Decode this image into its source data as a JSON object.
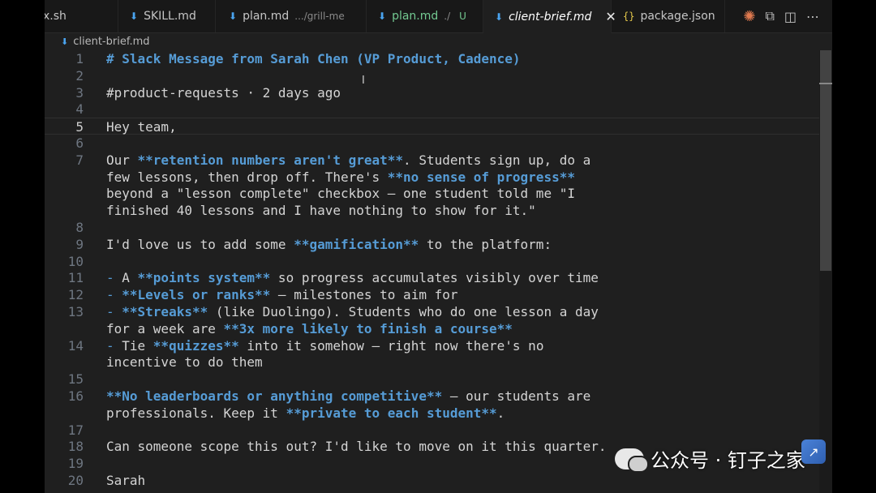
{
  "tabs": [
    {
      "label": "x.sh",
      "active": false
    },
    {
      "label": "SKILL.md",
      "active": false
    },
    {
      "label": "plan.md",
      "path": ".../grill-me",
      "active": false
    },
    {
      "label": "plan.md",
      "path": "./",
      "status": "U",
      "active": false
    },
    {
      "label": "client-brief.md",
      "active": true
    },
    {
      "label": "package.json",
      "active": false
    }
  ],
  "breadcrumb": "client-brief.md",
  "lines": [
    {
      "n": "1",
      "segs": [
        {
          "t": "# Slack Message from Sarah Chen (VP Product, Cadence)",
          "s": "h"
        }
      ]
    },
    {
      "n": "2",
      "segs": []
    },
    {
      "n": "3",
      "segs": [
        {
          "t": "#product-requests · 2 days ago",
          "s": ""
        }
      ]
    },
    {
      "n": "4",
      "segs": []
    },
    {
      "n": "5",
      "segs": [
        {
          "t": "Hey team,",
          "s": ""
        }
      ],
      "current": true
    },
    {
      "n": "6",
      "segs": []
    },
    {
      "n": "7",
      "segs": [
        {
          "t": "Our ",
          "s": ""
        },
        {
          "t": "**retention numbers aren't great**",
          "s": "b"
        },
        {
          "t": ". Students sign up, do a",
          "s": ""
        }
      ]
    },
    {
      "n": "",
      "segs": [
        {
          "t": "few lessons, then drop off. There's ",
          "s": ""
        },
        {
          "t": "**no sense of progress**",
          "s": "b"
        }
      ]
    },
    {
      "n": "",
      "segs": [
        {
          "t": "beyond a \"lesson complete\" checkbox — one student told me \"I",
          "s": ""
        }
      ]
    },
    {
      "n": "",
      "segs": [
        {
          "t": "finished 40 lessons and I have nothing to show for it.\"",
          "s": ""
        }
      ]
    },
    {
      "n": "8",
      "segs": []
    },
    {
      "n": "9",
      "segs": [
        {
          "t": "I'd love us to add some ",
          "s": ""
        },
        {
          "t": "**gamification**",
          "s": "b"
        },
        {
          "t": " to the platform:",
          "s": ""
        }
      ]
    },
    {
      "n": "10",
      "segs": []
    },
    {
      "n": "11",
      "segs": [
        {
          "t": "- ",
          "s": "dash"
        },
        {
          "t": "A ",
          "s": ""
        },
        {
          "t": "**points system**",
          "s": "b"
        },
        {
          "t": " so progress accumulates visibly over time",
          "s": ""
        }
      ]
    },
    {
      "n": "12",
      "segs": [
        {
          "t": "- ",
          "s": "dash"
        },
        {
          "t": "**Levels or ranks**",
          "s": "b"
        },
        {
          "t": " — milestones to aim for",
          "s": ""
        }
      ]
    },
    {
      "n": "13",
      "segs": [
        {
          "t": "- ",
          "s": "dash"
        },
        {
          "t": "**Streaks**",
          "s": "b"
        },
        {
          "t": " (like Duolingo). Students who do one lesson a day",
          "s": ""
        }
      ]
    },
    {
      "n": "",
      "segs": [
        {
          "t": "for a week are ",
          "s": ""
        },
        {
          "t": "**3x more likely to finish a course**",
          "s": "b"
        }
      ]
    },
    {
      "n": "14",
      "segs": [
        {
          "t": "- ",
          "s": "dash"
        },
        {
          "t": "Tie ",
          "s": ""
        },
        {
          "t": "**quizzes**",
          "s": "b"
        },
        {
          "t": " into it somehow — right now there's no",
          "s": ""
        }
      ]
    },
    {
      "n": "",
      "segs": [
        {
          "t": "incentive to do them",
          "s": ""
        }
      ]
    },
    {
      "n": "15",
      "segs": []
    },
    {
      "n": "16",
      "segs": [
        {
          "t": "**No leaderboards or anything competitive**",
          "s": "b"
        },
        {
          "t": " — our students are",
          "s": ""
        }
      ]
    },
    {
      "n": "",
      "segs": [
        {
          "t": "professionals. Keep it ",
          "s": ""
        },
        {
          "t": "**private to each student**",
          "s": "b"
        },
        {
          "t": ".",
          "s": ""
        }
      ]
    },
    {
      "n": "17",
      "segs": []
    },
    {
      "n": "18",
      "segs": [
        {
          "t": "Can someone scope this out? I'd like to move on it this quarter.",
          "s": ""
        }
      ]
    },
    {
      "n": "19",
      "segs": []
    },
    {
      "n": "20",
      "segs": [
        {
          "t": "Sarah",
          "s": ""
        }
      ]
    }
  ],
  "watermark": "公众号 · 钉子之家",
  "icons": {
    "markdown": "md-down-arrow-icon",
    "json": "json-braces-icon",
    "close": "close-icon",
    "actions": [
      "claude-spark-icon",
      "open-preview-icon",
      "split-editor-icon",
      "more-icon"
    ]
  },
  "colors": {
    "accent": "#569cd6",
    "modified": "#73c991",
    "background": "#1f1f1f"
  }
}
